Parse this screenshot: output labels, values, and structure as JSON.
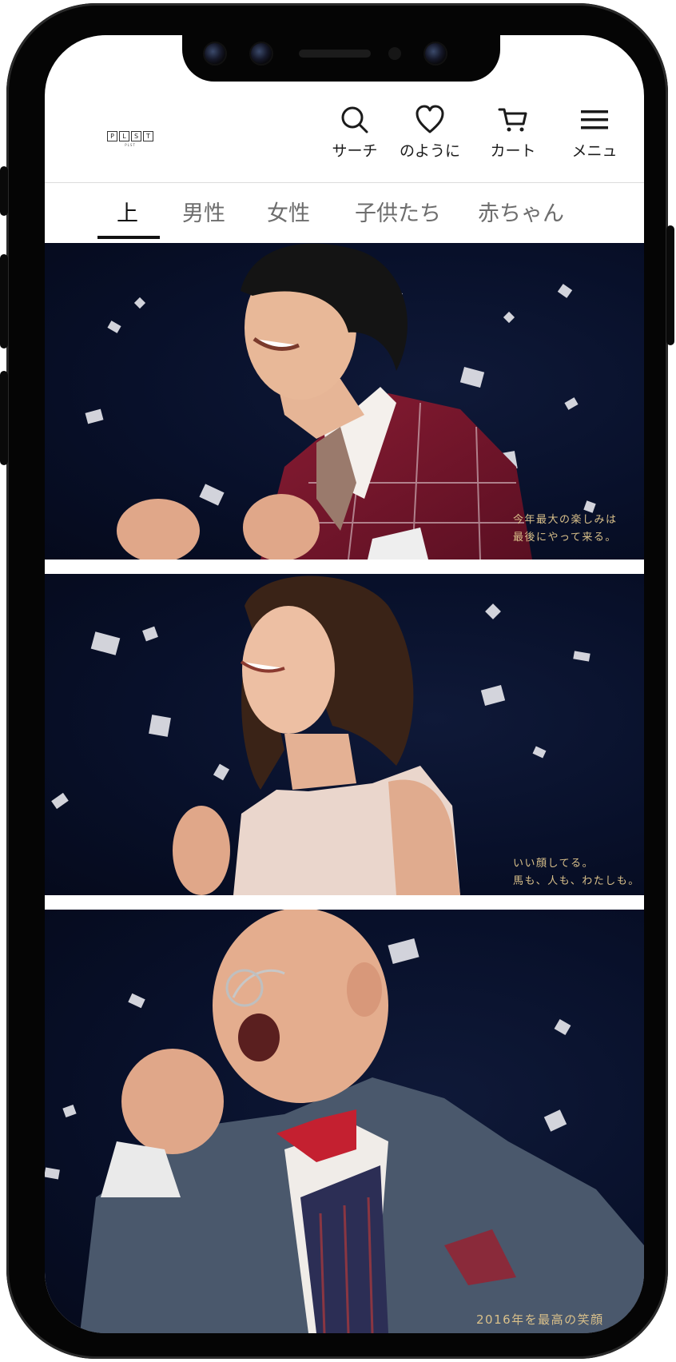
{
  "header": {
    "logo": {
      "letters": [
        "P",
        "L",
        "S",
        "T"
      ],
      "sub": "PLST"
    },
    "nav": [
      {
        "label": "サーチ",
        "icon": "search-icon"
      },
      {
        "label": "のように",
        "icon": "heart-icon"
      },
      {
        "label": "カート",
        "icon": "cart-icon"
      },
      {
        "label": "メニュ",
        "icon": "hamburger-menu-icon"
      }
    ]
  },
  "tabs": [
    {
      "label": "上",
      "active": true
    },
    {
      "label": "男性",
      "active": false
    },
    {
      "label": "女性",
      "active": false
    },
    {
      "label": "子供たち",
      "active": false
    },
    {
      "label": "赤ちゃん",
      "active": false
    }
  ],
  "banners": [
    {
      "caption_lines": [
        "今年最大の楽しみは",
        "最後にやって来る。"
      ]
    },
    {
      "caption_lines": [
        "いい顔してる。",
        "馬も、人も、わたしも。"
      ]
    },
    {
      "caption_lines": [
        "2016年を最高の笑顔"
      ]
    }
  ],
  "colors": {
    "banner_bg": "#08102a",
    "caption": "#d9c08a",
    "text": "#1b1b1b",
    "tab_inactive": "#6d6d6d"
  }
}
